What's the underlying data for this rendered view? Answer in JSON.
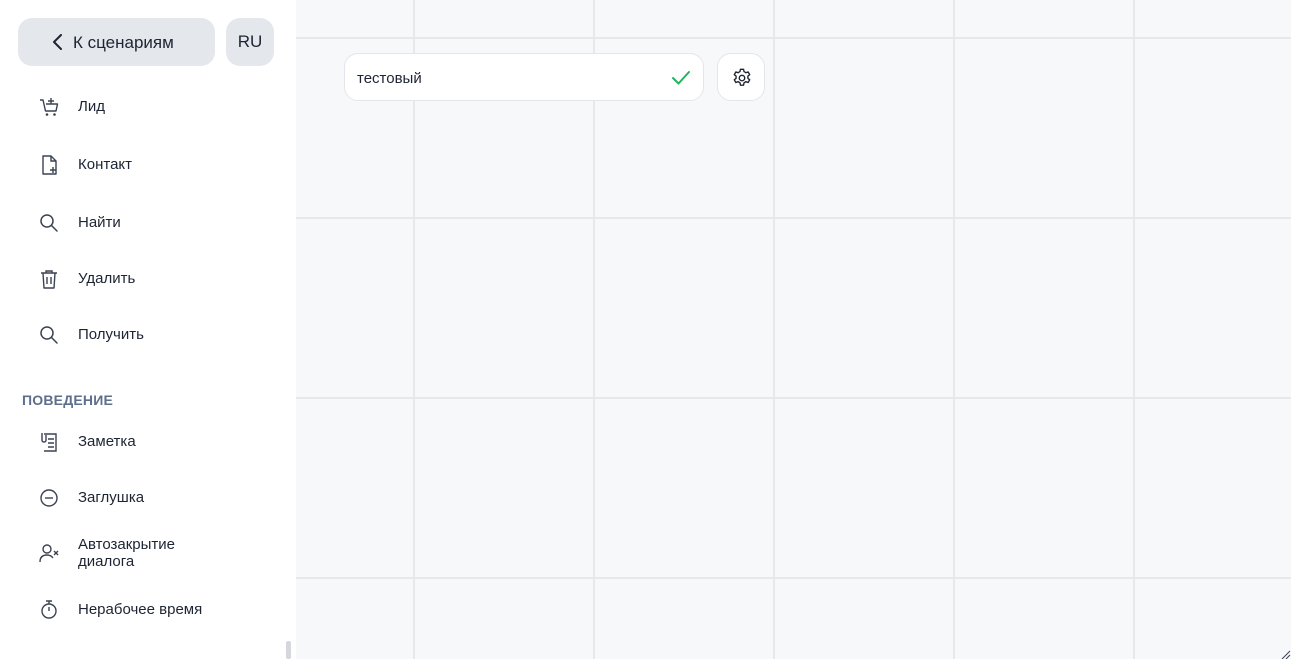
{
  "sidebar": {
    "back_label": "К сценариям",
    "lang_label": "RU",
    "items": [
      {
        "label": "Лид",
        "icon": "cart-plus-icon"
      },
      {
        "label": "Контакт",
        "icon": "file-plus-icon"
      },
      {
        "label": "Найти",
        "icon": "search-icon"
      },
      {
        "label": "Удалить",
        "icon": "trash-icon"
      },
      {
        "label": "Получить",
        "icon": "search-icon"
      }
    ],
    "section_behavior": "ПОВЕДЕНИЕ",
    "behavior_items": [
      {
        "label": "Заметка",
        "icon": "note-clip-icon"
      },
      {
        "label": "Заглушка",
        "icon": "minus-circle-icon"
      },
      {
        "label_line1": "Автозакрытие",
        "label_line2": "диалога",
        "icon": "user-x-icon"
      },
      {
        "label": "Нерабочее время",
        "icon": "stopwatch-icon"
      }
    ]
  },
  "editor": {
    "scenario_name": "тестовый",
    "confirm_icon": "check-icon",
    "settings_icon": "gear-icon"
  },
  "colors": {
    "accent_green": "#22b35e",
    "section_title": "#5d6f8c",
    "button_bg": "#e4e7ec",
    "canvas_bg": "#f7f8fa",
    "grid_line": "#e6e8ec"
  }
}
